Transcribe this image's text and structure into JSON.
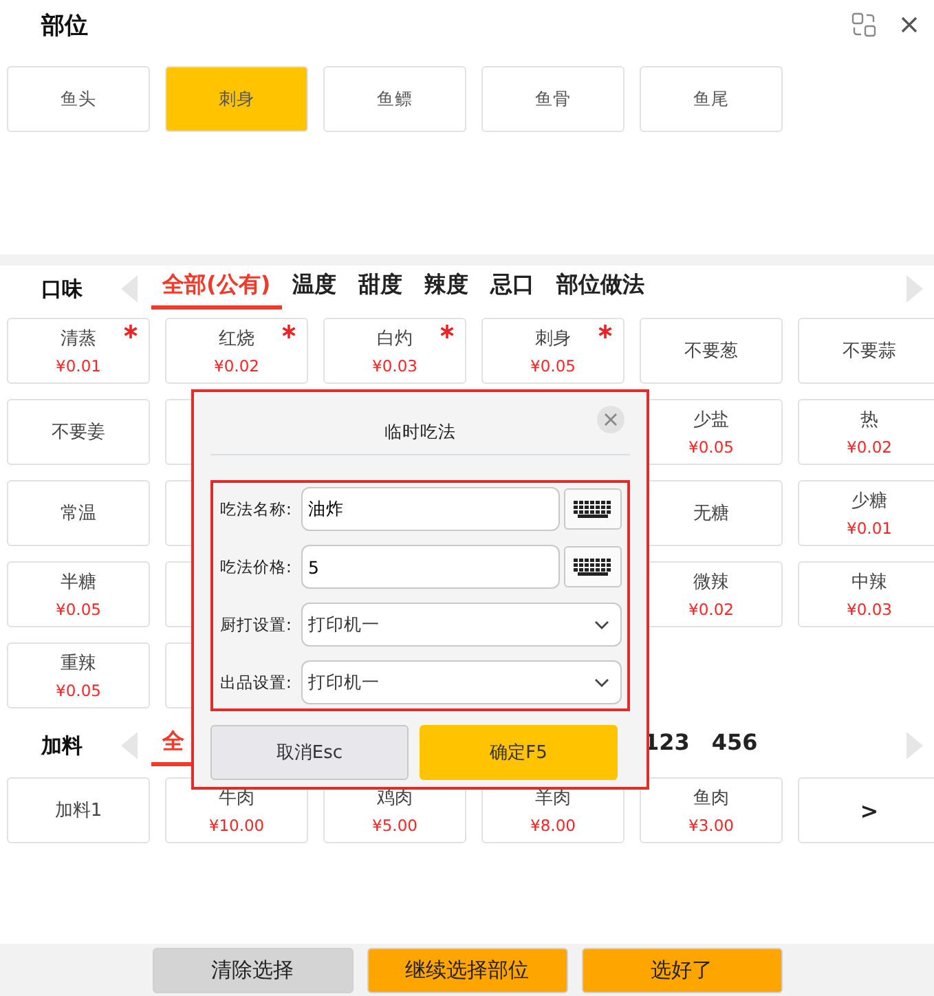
{
  "header": {
    "title": "部位"
  },
  "parts": [
    {
      "label": "鱼头",
      "selected": false
    },
    {
      "label": "刺身",
      "selected": true
    },
    {
      "label": "鱼鳔",
      "selected": false
    },
    {
      "label": "鱼骨",
      "selected": false
    },
    {
      "label": "鱼尾",
      "selected": false
    }
  ],
  "flavor": {
    "title": "口味",
    "tabs": [
      {
        "label": "全部(公有)",
        "selected": true
      },
      {
        "label": "温度",
        "selected": false
      },
      {
        "label": "甜度",
        "selected": false
      },
      {
        "label": "辣度",
        "selected": false
      },
      {
        "label": "忌口",
        "selected": false
      },
      {
        "label": "部位做法",
        "selected": false
      }
    ],
    "items": [
      {
        "kind": "item",
        "name": "清蒸",
        "price": "¥0.01",
        "required": true
      },
      {
        "kind": "item",
        "name": "红烧",
        "price": "¥0.02",
        "required": true
      },
      {
        "kind": "item",
        "name": "白灼",
        "price": "¥0.03",
        "required": true
      },
      {
        "kind": "item",
        "name": "刺身",
        "price": "¥0.05",
        "required": true
      },
      {
        "kind": "item",
        "name": "不要葱",
        "required": false
      },
      {
        "kind": "item",
        "name": "不要蒜",
        "required": false
      },
      {
        "kind": "item",
        "name": "不要姜",
        "required": false
      },
      {
        "kind": "covered"
      },
      {
        "kind": "gap"
      },
      {
        "kind": "gap"
      },
      {
        "kind": "item",
        "name": "少盐",
        "price": "¥0.05",
        "required": false
      },
      {
        "kind": "item",
        "name": "热",
        "price": "¥0.02",
        "required": false
      },
      {
        "kind": "item",
        "name": "常温",
        "required": false
      },
      {
        "kind": "covered"
      },
      {
        "kind": "gap"
      },
      {
        "kind": "gap"
      },
      {
        "kind": "item",
        "name": "无糖",
        "required": false
      },
      {
        "kind": "item",
        "name": "少糖",
        "price": "¥0.01",
        "required": false
      },
      {
        "kind": "item",
        "name": "半糖",
        "price": "¥0.05",
        "required": false
      },
      {
        "kind": "covered"
      },
      {
        "kind": "gap"
      },
      {
        "kind": "gap"
      },
      {
        "kind": "item",
        "name": "微辣",
        "price": "¥0.02",
        "required": false
      },
      {
        "kind": "item",
        "name": "中辣",
        "price": "¥0.03",
        "required": false
      },
      {
        "kind": "item",
        "name": "重辣",
        "price": "¥0.05",
        "required": false
      },
      {
        "kind": "covered"
      }
    ]
  },
  "addons": {
    "title": "加料",
    "tabs": [
      {
        "label": "全",
        "selected": true
      },
      {
        "label": "123",
        "selected": false
      },
      {
        "label": "456",
        "selected": false
      }
    ],
    "items": [
      {
        "kind": "item",
        "name": "加料1"
      },
      {
        "kind": "item",
        "name": "牛肉",
        "price": "¥10.00"
      },
      {
        "kind": "item",
        "name": "鸡肉",
        "price": "¥5.00"
      },
      {
        "kind": "item",
        "name": "羊肉",
        "price": "¥8.00"
      },
      {
        "kind": "item",
        "name": "鱼肉",
        "price": "¥3.00"
      },
      {
        "kind": "more",
        "name": ">"
      }
    ]
  },
  "dialog": {
    "title": "临时吃法",
    "fields": [
      {
        "kind": "text",
        "label": "吃法名称:",
        "value": "油炸"
      },
      {
        "kind": "text",
        "label": "吃法价格:",
        "value": "5"
      },
      {
        "kind": "select",
        "label": "厨打设置:",
        "value": "打印机一"
      },
      {
        "kind": "select",
        "label": "出品设置:",
        "value": "打印机一"
      }
    ],
    "buttons": [
      {
        "label": "取消Esc",
        "kind": "cancel"
      },
      {
        "label": "确定F5",
        "kind": "confirm"
      }
    ]
  },
  "footer": {
    "buttons": [
      {
        "label": "清除选择",
        "kind": "clear"
      },
      {
        "label": "继续选择部位",
        "kind": "continue"
      },
      {
        "label": "选好了",
        "kind": "done"
      }
    ]
  }
}
